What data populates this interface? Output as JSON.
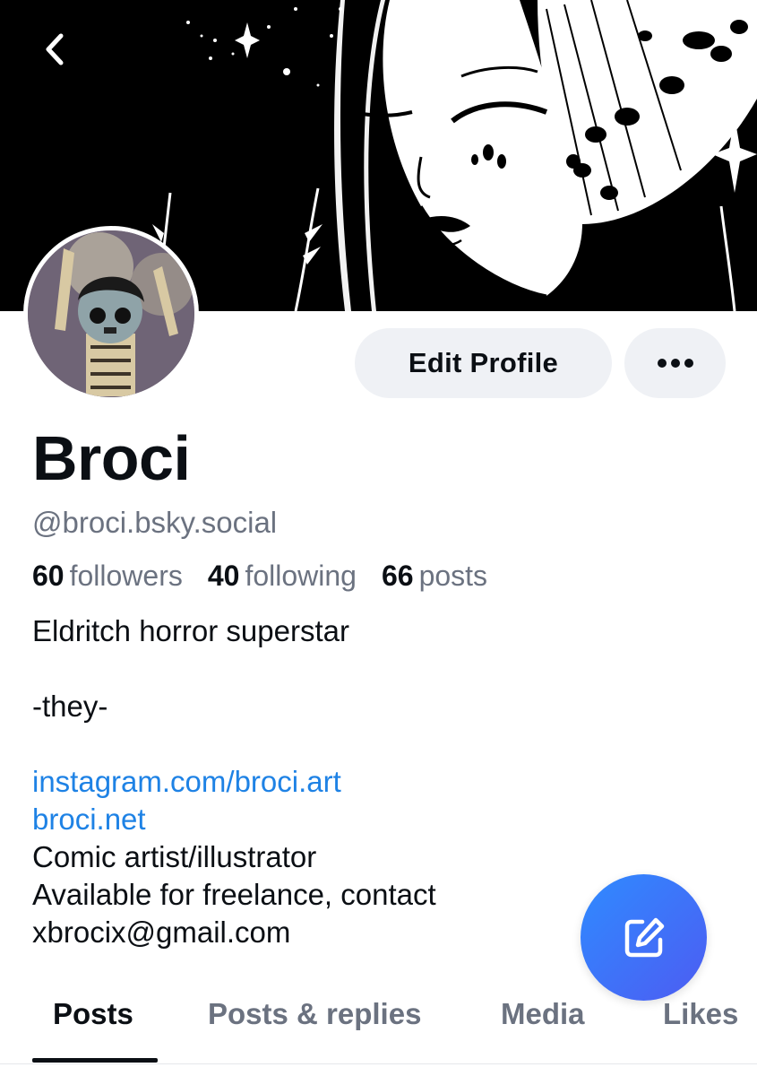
{
  "profile": {
    "display_name": "Broci",
    "handle": "@broci.bsky.social",
    "edit_profile_label": "Edit Profile"
  },
  "stats": {
    "followers": {
      "count": "60",
      "label": "followers"
    },
    "following": {
      "count": "40",
      "label": "following"
    },
    "posts": {
      "count": "66",
      "label": "posts"
    }
  },
  "bio": {
    "line1": "Eldritch horror superstar",
    "line2": "",
    "line3": "-they-",
    "line4": "",
    "link1": "instagram.com/broci.art",
    "link2": "broci.net",
    "line5": "Comic artist/illustrator",
    "line6": "Available for freelance, contact",
    "line7": "xbrocix@gmail.com"
  },
  "tabs": {
    "posts": "Posts",
    "posts_replies": "Posts & replies",
    "media": "Media",
    "likes": "Likes"
  },
  "colors": {
    "link": "#1e82e5",
    "fab": "#3b7bf8",
    "button_bg": "#eff1f5",
    "muted_text": "#6b7280"
  },
  "icons": {
    "back": "chevron-left-icon",
    "more": "more-horizontal-icon",
    "compose": "compose-icon"
  }
}
